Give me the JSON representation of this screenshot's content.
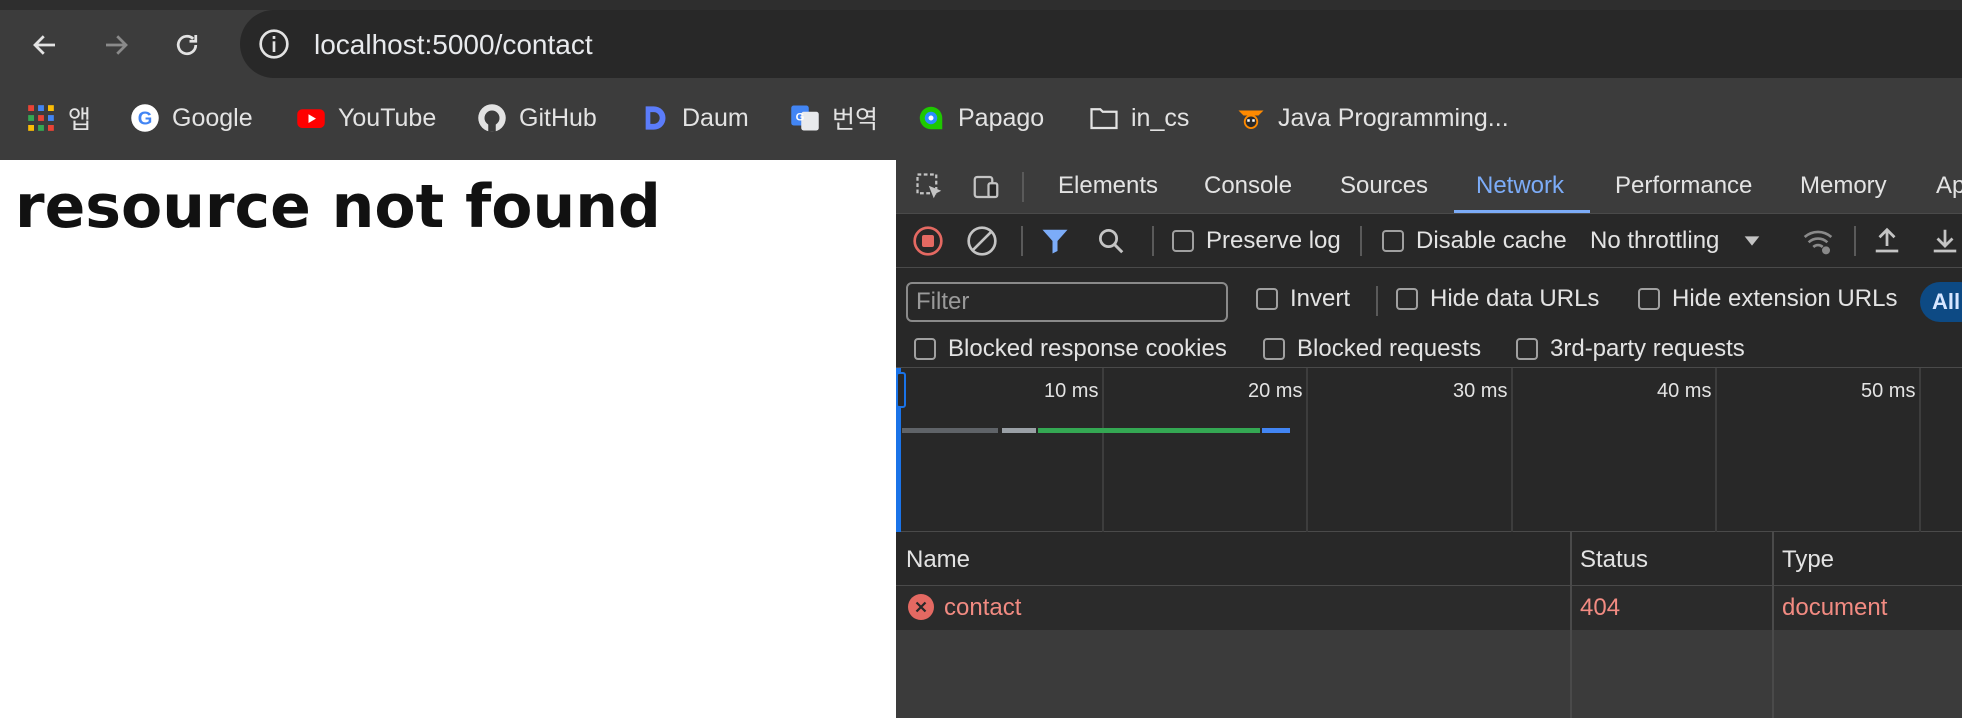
{
  "browser": {
    "url": "localhost:5000/contact",
    "nav": {
      "back_icon": "arrow-left-icon",
      "forward_icon": "arrow-right-icon",
      "reload_icon": "reload-icon",
      "info_icon": "info-icon"
    },
    "bookmarks": [
      {
        "label": "앱",
        "icon": "apps-grid-icon"
      },
      {
        "label": "Google",
        "icon": "google-icon"
      },
      {
        "label": "YouTube",
        "icon": "youtube-icon"
      },
      {
        "label": "GitHub",
        "icon": "github-icon"
      },
      {
        "label": "Daum",
        "icon": "daum-icon"
      },
      {
        "label": "번역",
        "icon": "translate-icon"
      },
      {
        "label": "Papago",
        "icon": "papago-icon"
      },
      {
        "label": "in_cs",
        "icon": "folder-icon"
      },
      {
        "label": "Java Programming...",
        "icon": "java-icon"
      }
    ]
  },
  "page": {
    "heading": "resource not found"
  },
  "devtools": {
    "tabs": [
      "Elements",
      "Console",
      "Sources",
      "Network",
      "Performance",
      "Memory",
      "Ap"
    ],
    "active_tab": "Network",
    "toolbar": {
      "preserve_log": "Preserve log",
      "disable_cache": "Disable cache",
      "throttling": "No throttling"
    },
    "filter": {
      "placeholder": "Filter",
      "invert": "Invert",
      "hide_data_urls": "Hide data URLs",
      "hide_extension_urls": "Hide extension URLs",
      "all": "All",
      "blocked_response_cookies": "Blocked response cookies",
      "blocked_requests": "Blocked requests",
      "third_party_requests": "3rd-party requests"
    },
    "timeline": {
      "ticks": [
        "10 ms",
        "20 ms",
        "30 ms",
        "40 ms",
        "50 ms"
      ]
    },
    "table": {
      "columns": [
        "Name",
        "Status",
        "Type"
      ],
      "rows": [
        {
          "name": "contact",
          "status": "404",
          "type": "document"
        }
      ]
    },
    "colors": {
      "active_tab": "#7cacf8",
      "error_text": "#f28b82",
      "record_red": "#e46962",
      "filter_blue": "#7cacf8"
    }
  }
}
